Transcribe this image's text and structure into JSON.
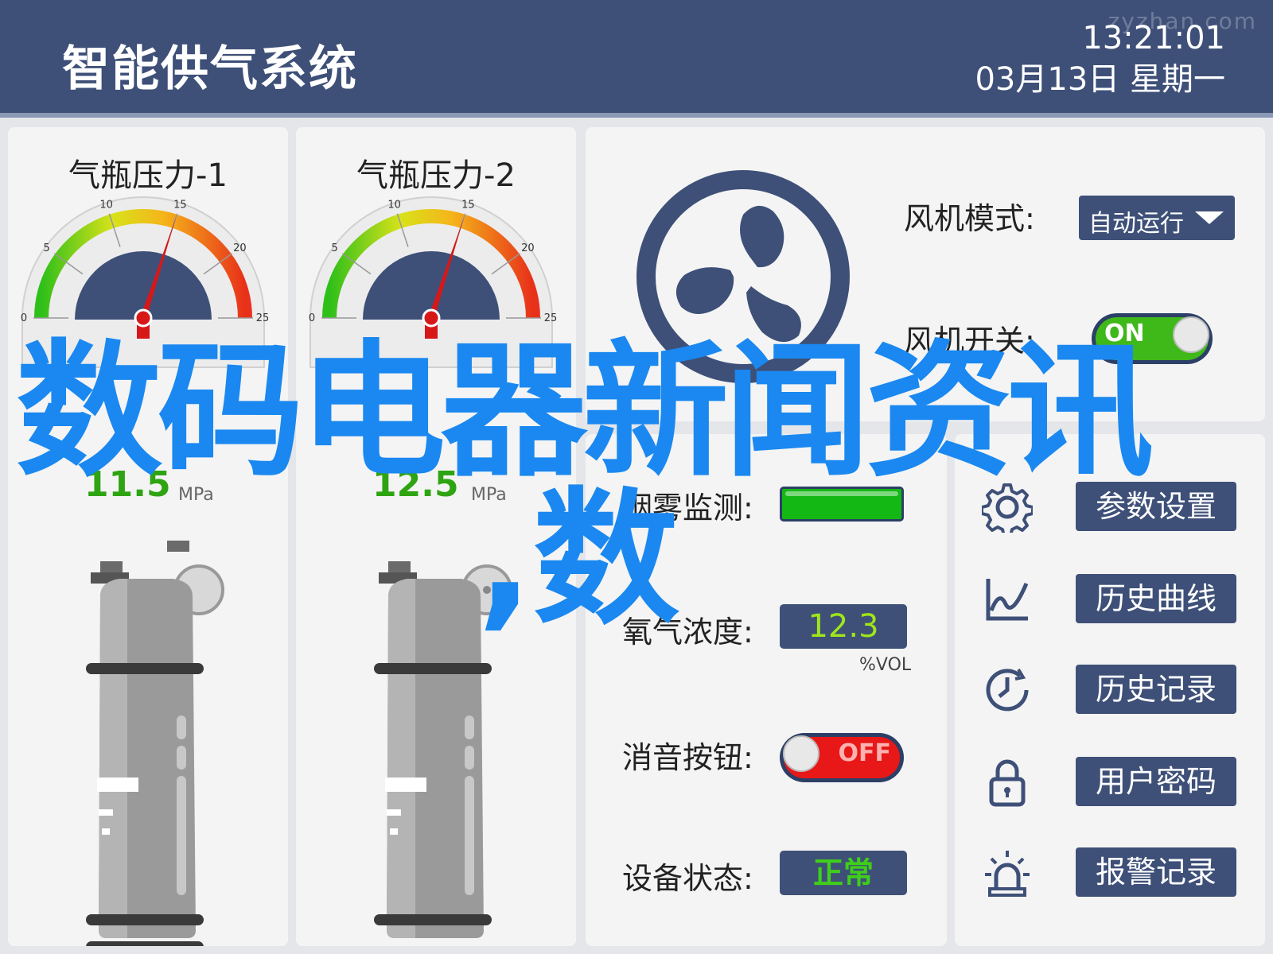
{
  "header": {
    "title": "智能供气系统",
    "time": "13:21:01",
    "date": "03月13日  星期一",
    "watermark": "zyzhan.com"
  },
  "gauges": [
    {
      "title": "气瓶压力-1",
      "value": "11.5",
      "unit": "MPa",
      "ticks": [
        "0",
        "5",
        "10",
        "15",
        "20",
        "25"
      ],
      "reading": 15
    },
    {
      "title": "气瓶压力-2",
      "value": "12.5",
      "unit": "MPa",
      "ticks": [
        "0",
        "5",
        "10",
        "15",
        "20",
        "25"
      ],
      "reading": 15
    }
  ],
  "fan": {
    "icon": "fan-icon",
    "mode_label": "风机模式:",
    "mode_value": "自动运行",
    "switch_label": "风机开关:",
    "switch_state": "ON"
  },
  "status": {
    "smoke_label": "烟雾监测:",
    "oxygen_label": "氧气浓度:",
    "oxygen_value": "12.3",
    "oxygen_unit": "%VOL",
    "mute_label": "消音按钮:",
    "mute_state": "OFF",
    "device_label": "设备状态:",
    "device_value": "正常"
  },
  "menu": {
    "items": [
      {
        "label": "参数设置",
        "icon": "gear-icon"
      },
      {
        "label": "历史曲线",
        "icon": "line-chart-icon"
      },
      {
        "label": "历史记录",
        "icon": "clock-icon"
      },
      {
        "label": "用户密码",
        "icon": "lock-icon"
      },
      {
        "label": "报警记录",
        "icon": "alarm-icon"
      }
    ]
  },
  "overlay": {
    "line1": "数码电器新闻资讯",
    "line2": ",数"
  },
  "colors": {
    "header_bg": "#3e5078",
    "accent_green": "#2ea412",
    "overlay_blue": "#1a88f0",
    "alarm_red": "#e81818"
  }
}
